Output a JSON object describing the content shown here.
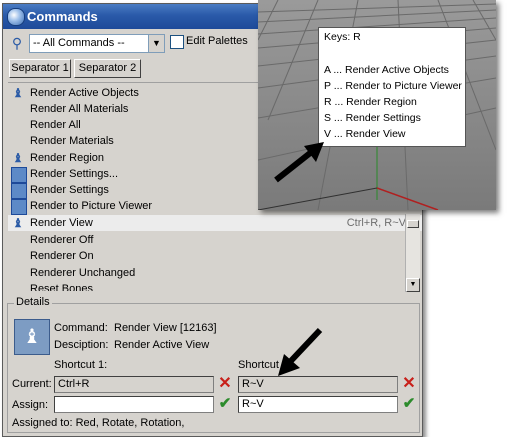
{
  "window": {
    "title": "Commands"
  },
  "toolbar": {
    "filter_value": "-- All Commands --",
    "edit_palettes_label": "Edit Palettes",
    "separator1_label": "Separator 1",
    "separator2_label": "Separator 2"
  },
  "commands": [
    {
      "label": "Render Active Objects",
      "icon": "teapot-icon",
      "shortcut": ""
    },
    {
      "label": "Render All Materials",
      "icon": "",
      "shortcut": ""
    },
    {
      "label": "Render All",
      "icon": "",
      "shortcut": ""
    },
    {
      "label": "Render Materials",
      "icon": "",
      "shortcut": ""
    },
    {
      "label": "Render Region",
      "icon": "teapot-icon",
      "shortcut": ""
    },
    {
      "label": "Render Settings...",
      "icon": "render-frame-icon",
      "shortcut": ""
    },
    {
      "label": "Render Settings",
      "icon": "render-frame-icon",
      "shortcut": ""
    },
    {
      "label": "Render to Picture Viewer",
      "icon": "render-frame-icon",
      "shortcut": ""
    },
    {
      "label": "Render View",
      "icon": "teapot-icon",
      "shortcut": "Ctrl+R, R~V"
    },
    {
      "label": "Renderer Off",
      "icon": "",
      "shortcut": ""
    },
    {
      "label": "Renderer On",
      "icon": "",
      "shortcut": ""
    },
    {
      "label": "Renderer Unchanged",
      "icon": "",
      "shortcut": ""
    },
    {
      "label": "Reset Bones",
      "icon": "",
      "shortcut": ""
    }
  ],
  "details": {
    "legend": "Details",
    "command_label": "Command:",
    "command_value": "Render View [12163]",
    "description_label": "Desciption:",
    "description_value": "Render Active View",
    "shortcut1_label": "Shortcut 1:",
    "shortcut2_label": "Shortcut",
    "current_label": "Current:",
    "assign_label": "Assign:",
    "current1": "Ctrl+R",
    "assign1": "",
    "current2": "R~V",
    "assign2": "R~V",
    "assigned_to": "Assigned to: Red, Rotate, Rotation,"
  },
  "keys_popup": {
    "title": "Keys: R",
    "items": [
      "A ... Render Active Objects",
      "P ... Render to Picture Viewer",
      "R ... Render Region",
      "S ... Render Settings",
      "V ... Render View"
    ]
  },
  "colors": {
    "titlebar": "#2a5aa9",
    "viewport_bg": "#8a8a8a",
    "delete": "#c8201a",
    "confirm": "#2c8b2c"
  }
}
